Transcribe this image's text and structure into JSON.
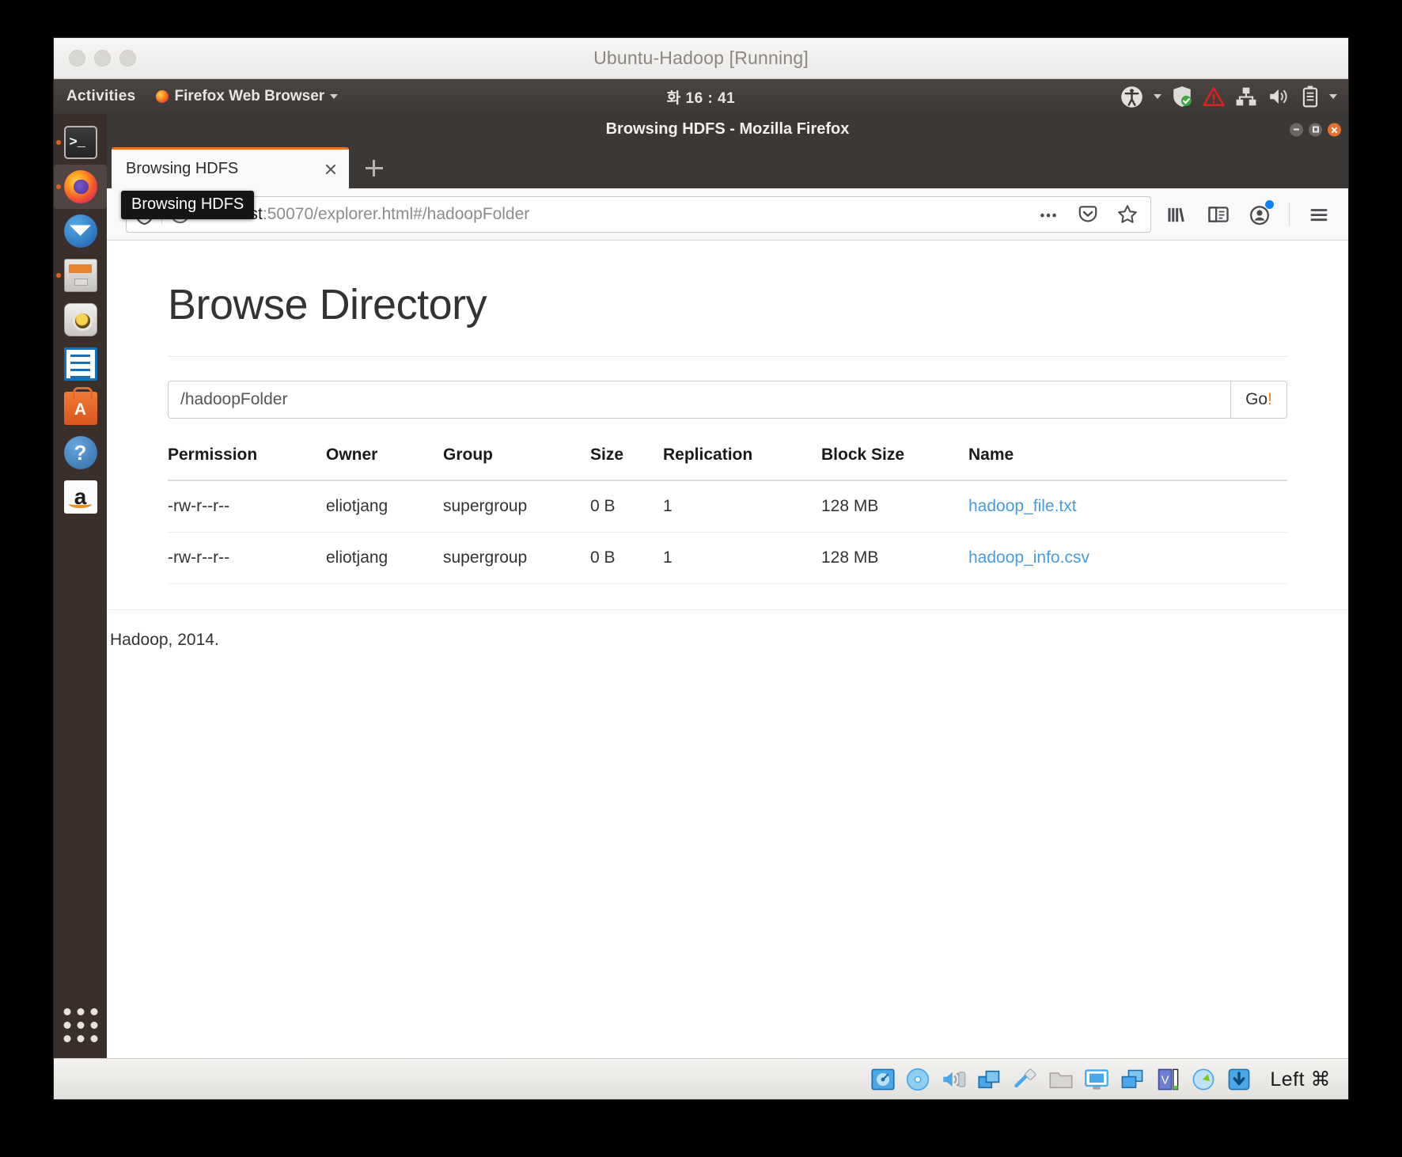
{
  "vbox": {
    "window_title": "Ubuntu-Hadoop [Running]",
    "statusbar": {
      "icons": [
        "hard-disk-icon",
        "optical-disk-icon",
        "audio-icon",
        "network-icon",
        "usb-icon",
        "shared-folders-icon",
        "display-icon",
        "remote-desktop-icon",
        "virtualization-icon",
        "mouse-integration-icon",
        "host-key-indicator-icon"
      ],
      "host_key_label": "Left ⌘"
    }
  },
  "gnome": {
    "activities_label": "Activities",
    "app_menu_label": "Firefox Web Browser",
    "clock": "화 16 : 41",
    "tray_icons": [
      "accessibility-icon",
      "chevron-down-icon",
      "shield-check-icon",
      "warning-triangle-icon",
      "network-wired-icon",
      "volume-icon",
      "battery-icon",
      "chevron-down-icon"
    ]
  },
  "firefox": {
    "window_title": "Browsing HDFS - Mozilla Firefox",
    "window_controls": [
      "minimize-button",
      "maximize-button",
      "close-button"
    ],
    "tab": {
      "label": "Browsing HDFS",
      "tooltip": "Browsing HDFS",
      "close_icon": "close-icon",
      "new_tab_icon": "plus-icon"
    },
    "urlbar": {
      "host": "localhost",
      "rest": ":50070/explorer.html#/hadoopFolder",
      "full_url": "localhost:50070/explorer.html#/hadoopFolder",
      "shield_icon": "tracking-protection-shield-icon",
      "info_icon": "page-info-icon",
      "action_icons": [
        "ellipsis-icon",
        "pocket-icon",
        "bookmark-star-icon"
      ]
    },
    "toolbar_right": [
      "library-icon",
      "sidebar-icon",
      "account-icon",
      "hamburger-menu-icon"
    ]
  },
  "dock": {
    "items": [
      {
        "name": "terminal",
        "running": true,
        "active": false
      },
      {
        "name": "firefox",
        "running": true,
        "active": true
      },
      {
        "name": "thunderbird",
        "running": false,
        "active": false
      },
      {
        "name": "files",
        "running": true,
        "active": false
      },
      {
        "name": "rhythmbox",
        "running": false,
        "active": false
      },
      {
        "name": "libreoffice-writer",
        "running": false,
        "active": false
      },
      {
        "name": "ubuntu-software",
        "running": false,
        "active": false
      },
      {
        "name": "help",
        "running": false,
        "active": false
      },
      {
        "name": "amazon",
        "running": false,
        "active": false
      }
    ],
    "show_applications_label": "Show Applications"
  },
  "page": {
    "title": "Browse Directory",
    "path_value": "/hadoopFolder",
    "path_placeholder": "",
    "go_label_text": "Go",
    "go_label_bang": "!",
    "table": {
      "headers": [
        "Permission",
        "Owner",
        "Group",
        "Size",
        "Replication",
        "Block Size",
        "Name"
      ],
      "rows": [
        {
          "permission": "-rw-r--r--",
          "owner": "eliotjang",
          "group": "supergroup",
          "size": "0 B",
          "replication": "1",
          "block_size": "128 MB",
          "name": "hadoop_file.txt"
        },
        {
          "permission": "-rw-r--r--",
          "owner": "eliotjang",
          "group": "supergroup",
          "size": "0 B",
          "replication": "1",
          "block_size": "128 MB",
          "name": "hadoop_info.csv"
        }
      ]
    },
    "footer": "Hadoop, 2014."
  },
  "colors": {
    "link_blue": "#4a9ae0",
    "firefox_accent": "#e8702e",
    "ubuntu_dock_bg": "#3b2f2c",
    "gnome_bar_bg": "#3c3835"
  }
}
